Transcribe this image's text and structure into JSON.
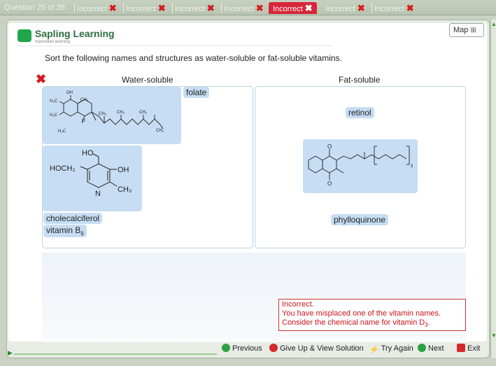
{
  "tabs": [
    {
      "label": "Question 25 of 26",
      "x": false
    },
    {
      "label": "Incorrect",
      "x": true
    },
    {
      "label": "Incorrect",
      "x": true
    },
    {
      "label": "Incorrect",
      "x": true
    },
    {
      "label": "Incorrect",
      "x": true
    },
    {
      "label": "Incorrect",
      "x": true,
      "active": true
    },
    {
      "label": "Incorrect",
      "x": true
    },
    {
      "label": "Incorrect",
      "x": true
    }
  ],
  "logo": {
    "name": "Sapling Learning",
    "sub": "macmillan learning"
  },
  "map_label": "Map",
  "instruction": "Sort the following names and structures as water-soluble or fat-soluble vitamins.",
  "columns": {
    "water": "Water-soluble",
    "fat": "Fat-soluble"
  },
  "water_items": {
    "folate": "folate",
    "cholecalciferol": "cholecalciferol",
    "vitamin_b6_main": "vitamin B",
    "vitamin_b6_sub": "6"
  },
  "fat_items": {
    "retinol": "retinol",
    "phylloquinone": "phylloquinone"
  },
  "structure_labels": {
    "oh": "OH",
    "h3c": "H₃C",
    "ch3": "CH₃",
    "o": "O",
    "ho": "HO",
    "hoch2": "HOCH₂",
    "n": "N",
    "three": "3"
  },
  "feedback": {
    "line1": "Incorrect.",
    "line2": "You have misplaced one of the vitamin names.",
    "line3_pre": "Consider the chemical name for vitamin D",
    "line3_sub": "3",
    "line3_post": "."
  },
  "buttons": {
    "previous": "Previous",
    "give_up": "Give Up & View Solution",
    "try_again": "Try Again",
    "next": "Next",
    "exit": "Exit"
  },
  "colors": {
    "accent_red": "#d8253a",
    "tile_blue": "#c6ddf3",
    "green": "#2ea043"
  }
}
